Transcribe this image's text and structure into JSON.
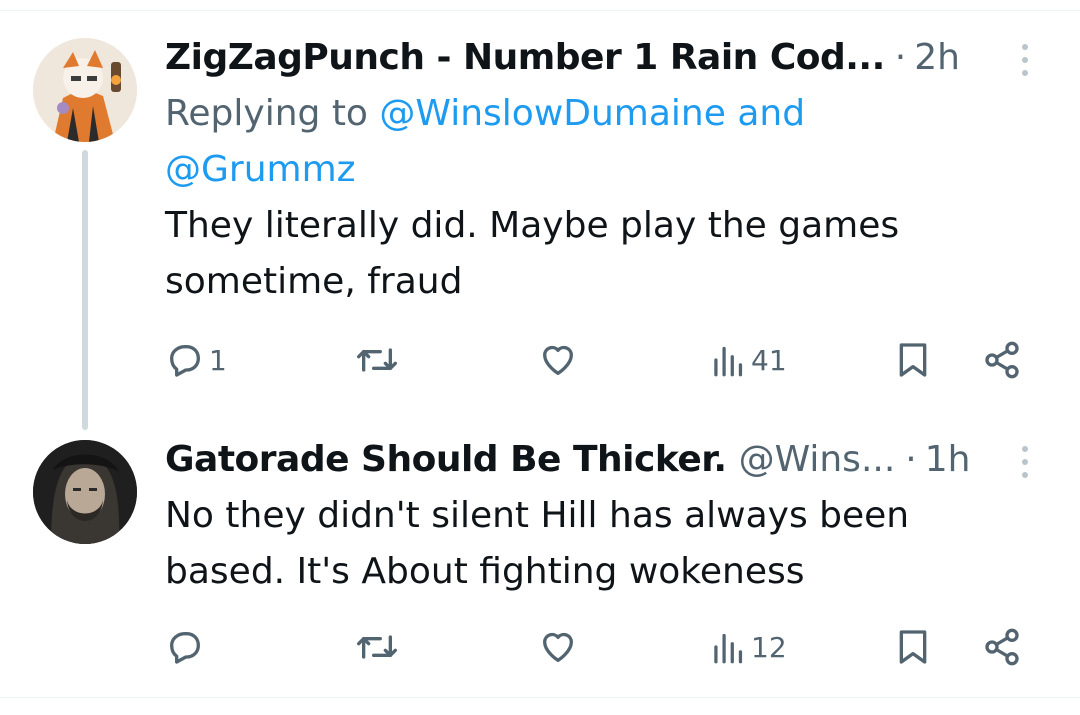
{
  "tweets": [
    {
      "name": "ZigZagPunch - Number 1 Rain Cod...",
      "time": "2h",
      "replying_prefix": "Replying to ",
      "replying_to_1": "@WinslowDumaine",
      "replying_joiner": " and",
      "replying_to_2": "@Grummz",
      "text": "They literally did. Maybe play the games sometime, fraud",
      "reply_count": "1",
      "retweet_count": "",
      "like_count": "",
      "views_count": "41"
    },
    {
      "name": "Gatorade Should Be Thicker.",
      "handle": "@Wins...",
      "time": "1h",
      "text": "No they didn't silent Hill has always been based. It's About fighting wokeness",
      "reply_count": "",
      "retweet_count": "",
      "like_count": "",
      "views_count": "12"
    }
  ],
  "colors": {
    "link": "#1d9bf0",
    "secondary_text": "#536471",
    "primary_text": "#0f1419",
    "thread_line": "#cfd9de"
  },
  "icons": [
    "reply-icon",
    "retweet-icon",
    "like-icon",
    "views-icon",
    "bookmark-icon",
    "share-icon",
    "more-icon"
  ]
}
